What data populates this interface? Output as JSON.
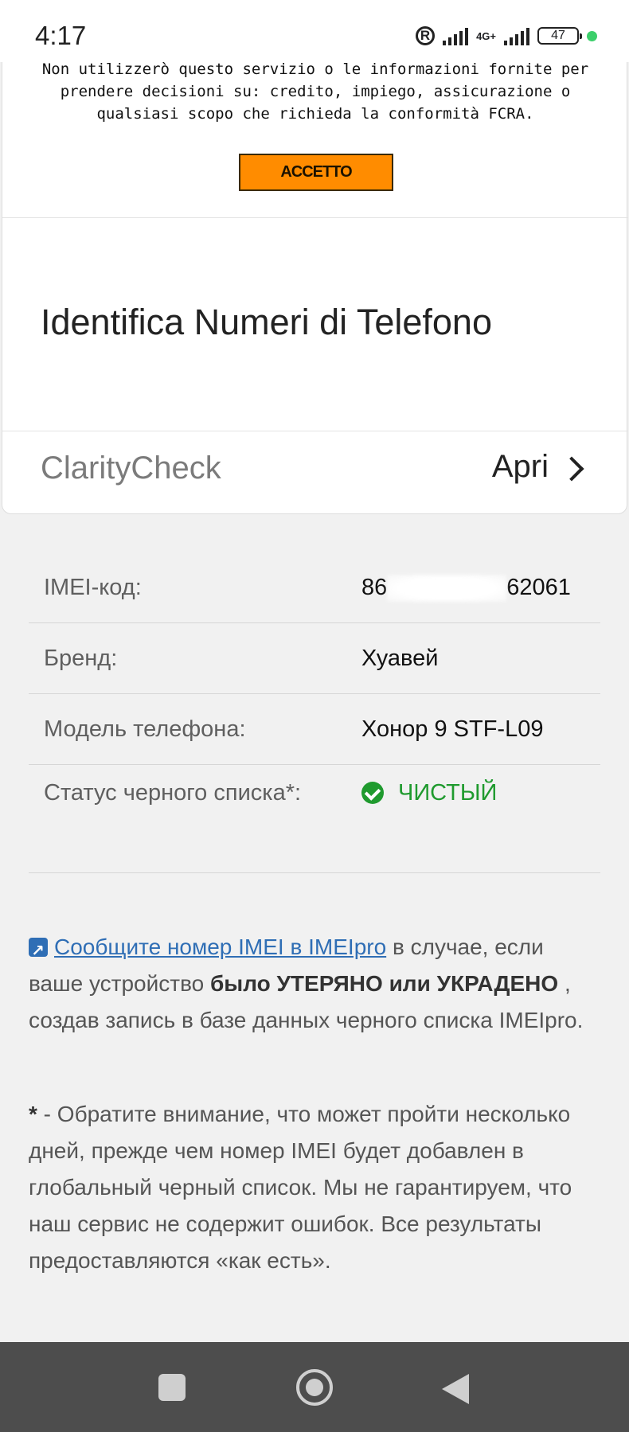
{
  "status_bar": {
    "time": "4:17",
    "network": "4G+",
    "battery": "47"
  },
  "ad": {
    "disclaimer_lines": [
      "Non utilizzerò questo servizio o le informazioni fornite per",
      "prendere decisioni su: credito, impiego, assicurazione o",
      "qualsiasi scopo che richieda la conformità FCRA."
    ],
    "accept_label": "ACCETTO",
    "title": "Identifica Numeri di Telefono",
    "brand": "ClarityCheck",
    "open_label": "Apri"
  },
  "info": {
    "rows": [
      {
        "label": "IMEI-код:",
        "value_prefix": "86",
        "value_suffix": "62061"
      },
      {
        "label": "Бренд:",
        "value": "Хуавей"
      },
      {
        "label": "Модель телефона:",
        "value": "Хонор 9 STF-L09"
      },
      {
        "label": "Статус черного списка*:",
        "value": "ЧИСТЫЙ"
      }
    ]
  },
  "report": {
    "link_text": "Сообщите номер IMEI в IMEIpro",
    "text_1": " в случае, если ваше устройство ",
    "bold": "было УТЕРЯНО или УКРАДЕНО",
    "text_2": " , создав запись в базе данных черного списка IMEIpro."
  },
  "note": {
    "star": "*",
    "text": " - Обратите внимание, что может пройти несколько дней, прежде чем номер IMEI будет добавлен в глобальный черный список. Мы не гарантируем, что наш сервис не содержит ошибок. Все результаты предоставляются «как есть»."
  },
  "colors": {
    "accept_button": "#ff8c00",
    "link": "#2f6eb5",
    "clean_status": "#1f9a2e",
    "navbar": "#4d4d4d"
  },
  "icons": [
    "registered-icon",
    "signal-icon",
    "battery-icon",
    "chevron-right-icon",
    "check-circle-icon",
    "external-link-icon",
    "recents-icon",
    "home-icon",
    "back-icon"
  ]
}
